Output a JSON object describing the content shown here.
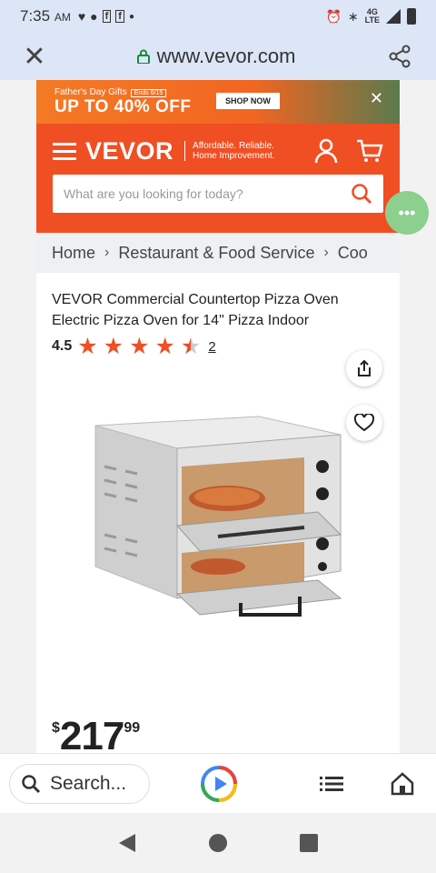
{
  "status": {
    "time": "7:35",
    "ampm": "AM",
    "network": "4G",
    "network_sub": "LTE"
  },
  "browser": {
    "url": "www.vevor.com"
  },
  "promo": {
    "small_text": "Father's Day Gifts",
    "ends": "Ends 6/15",
    "headline": "UP TO 40% OFF",
    "cta": "SHOP NOW"
  },
  "header": {
    "brand": "VEVOR",
    "tagline_line1": "Affordable. Reliable.",
    "tagline_line2": "Home Improvement.",
    "search_placeholder": "What are you looking for today?"
  },
  "breadcrumb": [
    "Home",
    "Restaurant & Food Service",
    "Coo"
  ],
  "product": {
    "title": "VEVOR Commercial Countertop Pizza Oven Electric Pizza Oven for 14\" Pizza Indoor",
    "rating": "4.5",
    "rating_value": 4.5,
    "review_count": "2",
    "price_currency": "$",
    "price_whole": "217",
    "price_cents": "99"
  },
  "bottom_bar": {
    "search_label": "Search..."
  },
  "colors": {
    "brand": "#f04e23",
    "browser_bar": "#dde6f7"
  }
}
